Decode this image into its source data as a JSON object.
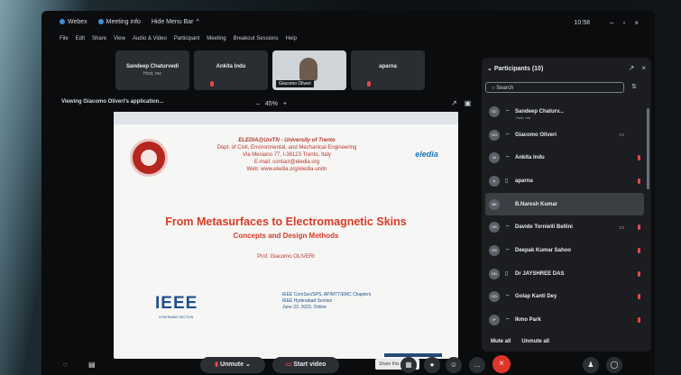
{
  "topbar": {
    "app_name": "Webex",
    "meeting_info": "Meeting info",
    "hide_menu": "Hide Menu Bar",
    "clock": "10:58"
  },
  "menu": [
    "File",
    "Edit",
    "Share",
    "View",
    "Audio & Video",
    "Participant",
    "Meeting",
    "Breakout Sessions",
    "Help"
  ],
  "thumbnails": [
    {
      "name": "Sandeep Chaturvedi",
      "sub": "Host, me"
    },
    {
      "name": "Ankita Indu",
      "sub": ""
    },
    {
      "name": "Giacomo Oliveri",
      "sub": ""
    },
    {
      "name": "aparna",
      "sub": ""
    }
  ],
  "share": {
    "viewing": "Viewing Giacomo Oliveri's application...",
    "zoom": "45%"
  },
  "slide": {
    "affiliation_title": "ELEDIA@UniTN - University of Trento",
    "dept": "Dept. of Civil, Environmental, and Mechanical Engineering",
    "address": "Via Mesiano 77, I-38123 Trento, Italy",
    "email": "E-mail: contact@eledia.org",
    "web": "Web: www.eledia.org/eledia-unitn",
    "eledia_logo": "eledia",
    "title": "From Metasurfaces to Electromagnetic Skins",
    "subtitle": "Concepts and Design Methods",
    "author": "Prof. Giacomo OLIVERI",
    "ieee": "IEEE",
    "ieee_sub": "HYDERABAD SECTION",
    "info1": "IEEE ComSoc/SPS, AP/MTT/EMC Chapters",
    "info2": "IEEE Hyderabad Section",
    "info3": "June 23, 2023, Online"
  },
  "panel": {
    "title": "Participants (10)",
    "search_placeholder": "Search",
    "participants": [
      {
        "initials": "SC",
        "name": "Sandeep Chaturv...",
        "sub": "Host, me",
        "mic": false,
        "video": false
      },
      {
        "initials": "GO",
        "name": "Giacomo Oliveri",
        "sub": "",
        "mic": false,
        "video": true
      },
      {
        "initials": "AI",
        "name": "Ankita Indu",
        "sub": "",
        "mic": true,
        "video": false
      },
      {
        "initials": "A",
        "name": "aparna",
        "sub": "",
        "mic": true,
        "video": false
      },
      {
        "initials": "BK",
        "name": "B.Naresh Kumar",
        "sub": "",
        "mic": false,
        "video": false
      },
      {
        "initials": "DB",
        "name": "Davide Tornielli Bellini",
        "sub": "",
        "mic": true,
        "video": true
      },
      {
        "initials": "DS",
        "name": "Deepak Kumar Sahoo",
        "sub": "",
        "mic": true,
        "video": false
      },
      {
        "initials": "DD",
        "name": "Dr JAYSHREE DAS",
        "sub": "",
        "mic": true,
        "video": false
      },
      {
        "initials": "GD",
        "name": "Golap Kanti Dey",
        "sub": "",
        "mic": true,
        "video": false
      },
      {
        "initials": "IP",
        "name": "Ikmo Park",
        "sub": "",
        "mic": true,
        "video": false
      }
    ],
    "mute_all": "Mute all",
    "unmute_all": "Unmute all"
  },
  "bottom": {
    "unmute": "Unmute",
    "start_video": "Start video",
    "tooltip": "Share this window"
  }
}
